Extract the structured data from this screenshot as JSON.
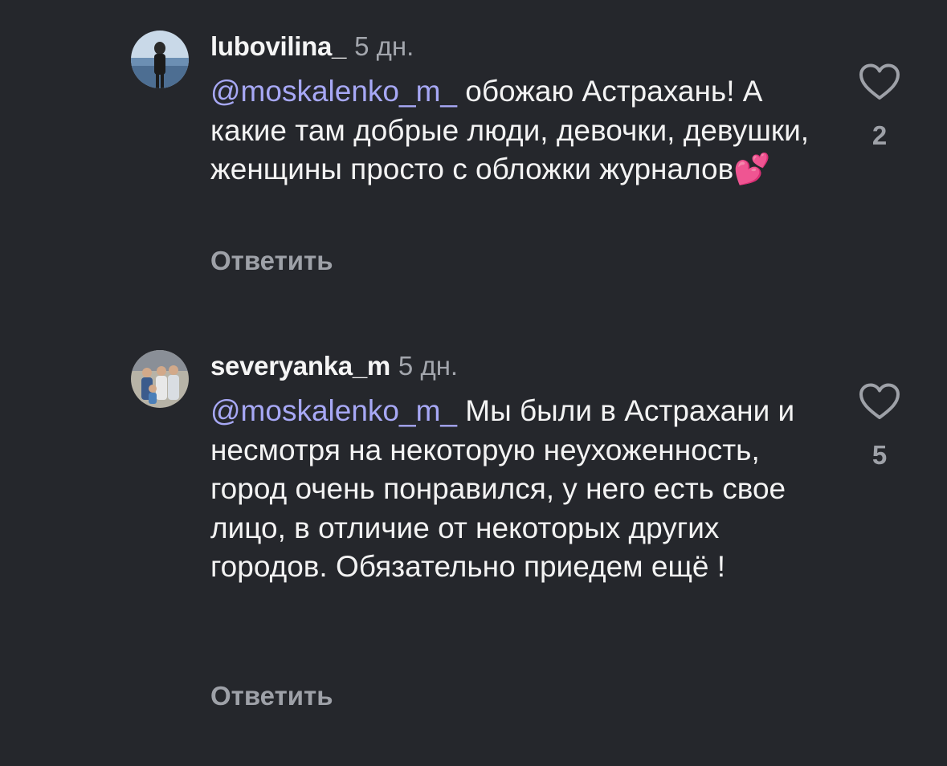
{
  "comments": [
    {
      "username": "lubovilina_",
      "time": "5 дн.",
      "mention": "@moskalenko_m_",
      "text": " обожаю Астрахань! А какие там добрые люди, девочки, девушки, женщины просто с обложки журналов",
      "emoji": "💕",
      "reply_label": "Ответить",
      "likes": "2"
    },
    {
      "username": "severyanka_m",
      "time": "5 дн.",
      "mention": "@moskalenko_m_",
      "text": " Мы были в Астрахани и несмотря на некоторую неухоженность, город очень понравился, у него есть свое лицо, в отличие от некоторых  других городов. Обязательно приедем ещё !",
      "reply_label": "Ответить",
      "likes": "5"
    }
  ],
  "icons": {
    "like": "heart-outline-icon"
  },
  "colors": {
    "background": "#25272c",
    "mention": "#a7a8f5",
    "muted": "#9ea1a8"
  }
}
